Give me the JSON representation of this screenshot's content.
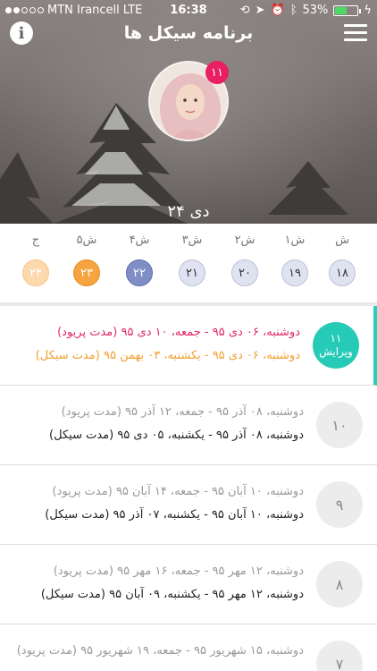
{
  "status_bar": {
    "carrier": "MTN Irancell",
    "network": "LTE",
    "time": "16:38",
    "battery_percent": "53%",
    "battery_level": 0.53
  },
  "nav": {
    "title": "برنامه سیکل ها",
    "info_label": "i"
  },
  "profile": {
    "badge": "۱۱",
    "date": "۲۴ دی"
  },
  "week": [
    {
      "label": "ش",
      "day": "۱۸",
      "style": "default"
    },
    {
      "label": "۱ش",
      "day": "۱۹",
      "style": "default"
    },
    {
      "label": "۲ش",
      "day": "۲۰",
      "style": "default"
    },
    {
      "label": "۳ش",
      "day": "۲۱",
      "style": "default"
    },
    {
      "label": "۴ش",
      "day": "۲۲",
      "style": "blue"
    },
    {
      "label": "۵ش",
      "day": "۲۳",
      "style": "orange"
    },
    {
      "label": "ج",
      "day": "۲۴",
      "style": "peach"
    }
  ],
  "cycles": [
    {
      "number": "۱۱",
      "action": "ویرایش",
      "period": "دوشنبه، ۰۶ دی ۹۵ - جمعه، ۱۰ دی ۹۵ (مدت پریود)",
      "cycle": "دوشنبه، ۰۶ دی ۹۵ - یکشنبه، ۰۳ بهمن ۹۵ (مدت سیکل)",
      "active": true
    },
    {
      "number": "۱۰",
      "period": "دوشنبه، ۰۸ آذر ۹۵ - جمعه، ۱۲ آذر ۹۵ (مدت پریود)",
      "cycle": "دوشنبه، ۰۸ آذر ۹۵ - یکشنبه، ۰۵ دی ۹۵ (مدت سیکل)"
    },
    {
      "number": "۹",
      "period": "دوشنبه، ۱۰ آبان ۹۵ - جمعه، ۱۴ آبان ۹۵ (مدت پریود)",
      "cycle": "دوشنبه، ۱۰ آبان ۹۵ - یکشنبه، ۰۷ آذر ۹۵ (مدت سیکل)"
    },
    {
      "number": "۸",
      "period": "دوشنبه، ۱۲ مهر ۹۵ - جمعه، ۱۶ مهر ۹۵ (مدت پریود)",
      "cycle": "دوشنبه، ۱۲ مهر ۹۵ - یکشنبه، ۰۹ آبان ۹۵ (مدت سیکل)"
    },
    {
      "number": "۷",
      "period": "دوشنبه، ۱۵ شهریور ۹۵ - جمعه، ۱۹ شهریور ۹۵ (مدت پریود)",
      "cycle": ""
    }
  ],
  "colors": {
    "accent_teal": "#26cbb7",
    "period_pink": "#e3266a",
    "cycle_orange": "#f2a031",
    "badge_pink": "#e91e63"
  }
}
